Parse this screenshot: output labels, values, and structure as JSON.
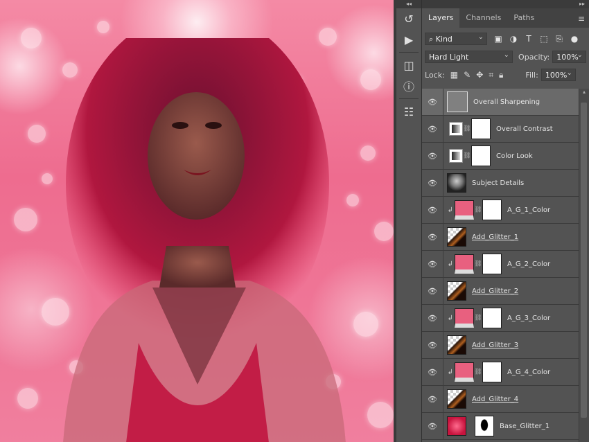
{
  "panel": {
    "tabs": [
      "Layers",
      "Channels",
      "Paths"
    ],
    "filter_kind": "Kind",
    "blend_mode": "Hard Light",
    "opacity_label": "Opacity:",
    "opacity_value": "100%",
    "lock_label": "Lock:",
    "fill_label": "Fill:",
    "fill_value": "100%"
  },
  "layers": [
    {
      "name": "Overall Sharpening",
      "type": "gray",
      "selected": true
    },
    {
      "name": "Overall Contrast",
      "type": "adjustment"
    },
    {
      "name": "Color Look",
      "type": "adjustment"
    },
    {
      "name": "Subject Details",
      "type": "photo"
    },
    {
      "name": "A_G_1_Color",
      "type": "color",
      "clipped": true
    },
    {
      "name": "Add_Glitter_1",
      "type": "glitter",
      "underlined": true
    },
    {
      "name": "A_G_2_Color",
      "type": "color",
      "clipped": true
    },
    {
      "name": "Add_Glitter_2",
      "type": "glitter",
      "underlined": true
    },
    {
      "name": "A_G_3_Color",
      "type": "color",
      "clipped": true
    },
    {
      "name": "Add_Glitter_3",
      "type": "glitter",
      "underlined": true
    },
    {
      "name": "A_G_4_Color",
      "type": "color",
      "clipped": true
    },
    {
      "name": "Add_Glitter_4",
      "type": "glitter",
      "underlined": true
    },
    {
      "name": "Base_Glitter_1",
      "type": "base"
    }
  ],
  "colors": {
    "color_fill": "#e8607f",
    "selected_row": "#6a6a6a"
  }
}
